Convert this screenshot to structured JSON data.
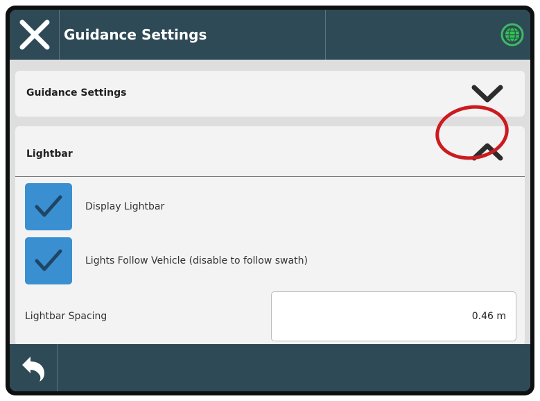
{
  "header": {
    "title": "Guidance Settings",
    "close_icon": "close-icon",
    "globe_icon": "globe-icon"
  },
  "sections": [
    {
      "label": "Guidance Settings",
      "expanded": false,
      "chevron": "chevron-down-icon"
    },
    {
      "label": "Lightbar",
      "expanded": true,
      "chevron": "chevron-up-icon"
    }
  ],
  "lightbar": {
    "options": [
      {
        "label": "Display Lightbar",
        "checked": true
      },
      {
        "label": "Lights Follow Vehicle (disable to follow swath)",
        "checked": true
      }
    ],
    "spacing": {
      "label": "Lightbar Spacing",
      "value": "0.46 m"
    }
  },
  "footer": {
    "back_icon": "back-arrow-icon"
  },
  "colors": {
    "header_bg": "#2e4a56",
    "checkbox_blue": "#3a8fd0",
    "highlight_red": "#cc1b1f",
    "globe_green": "#3dbb63"
  }
}
